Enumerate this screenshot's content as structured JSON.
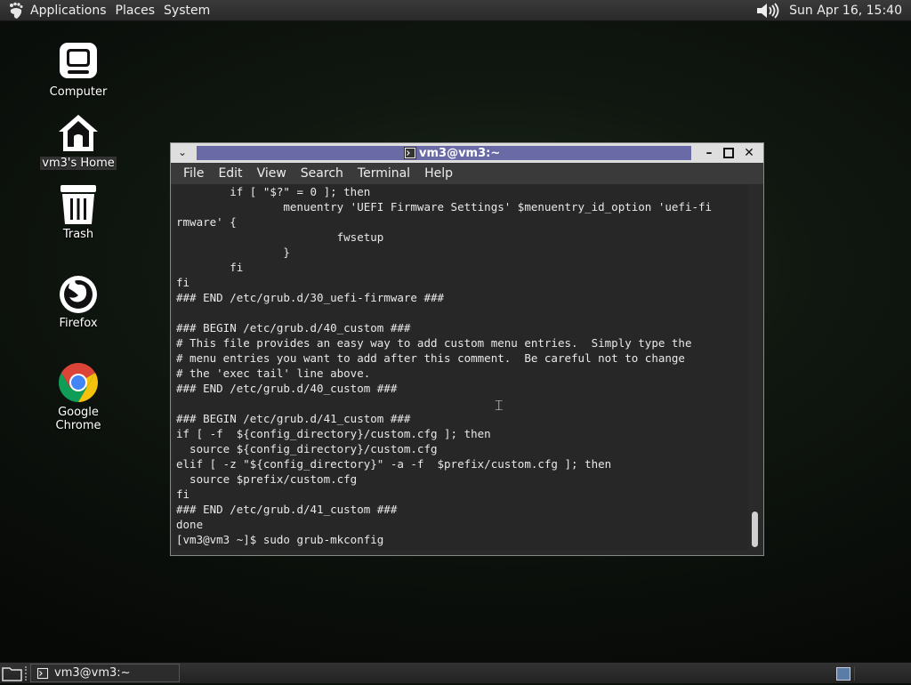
{
  "top_panel": {
    "menus": [
      "Applications",
      "Places",
      "System"
    ],
    "clock": "Sun Apr 16, 15:40",
    "icons": [
      "gnome-foot-icon",
      "volume-icon"
    ]
  },
  "desktop": {
    "icons": [
      {
        "label": "Computer",
        "icon": "computer-icon"
      },
      {
        "label": "vm3's Home",
        "icon": "home-icon"
      },
      {
        "label": "Trash",
        "icon": "trash-icon"
      },
      {
        "label": "Firefox",
        "icon": "firefox-icon"
      },
      {
        "label": "Google Chrome",
        "icon": "chrome-icon"
      }
    ]
  },
  "terminal": {
    "title": "vm3@vm3:~",
    "menu": [
      "File",
      "Edit",
      "View",
      "Search",
      "Terminal",
      "Help"
    ],
    "lines": [
      "        if [ \"$?\" = 0 ]; then",
      "                menuentry 'UEFI Firmware Settings' $menuentry_id_option 'uefi-fi",
      "rmware' {",
      "                        fwsetup",
      "                }",
      "        fi",
      "fi",
      "### END /etc/grub.d/30_uefi-firmware ###",
      "",
      "### BEGIN /etc/grub.d/40_custom ###",
      "# This file provides an easy way to add custom menu entries.  Simply type the",
      "# menu entries you want to add after this comment.  Be careful not to change",
      "# the 'exec tail' line above.",
      "### END /etc/grub.d/40_custom ###",
      "",
      "### BEGIN /etc/grub.d/41_custom ###",
      "if [ -f  ${config_directory}/custom.cfg ]; then",
      "  source ${config_directory}/custom.cfg",
      "elif [ -z \"${config_directory}\" -a -f  $prefix/custom.cfg ]; then",
      "  source $prefix/custom.cfg",
      "fi",
      "### END /etc/grub.d/41_custom ###",
      "done",
      "[vm3@vm3 ~]$ sudo grub-mkconfig"
    ]
  },
  "taskbar": {
    "task_label": "vm3@vm3:~"
  }
}
